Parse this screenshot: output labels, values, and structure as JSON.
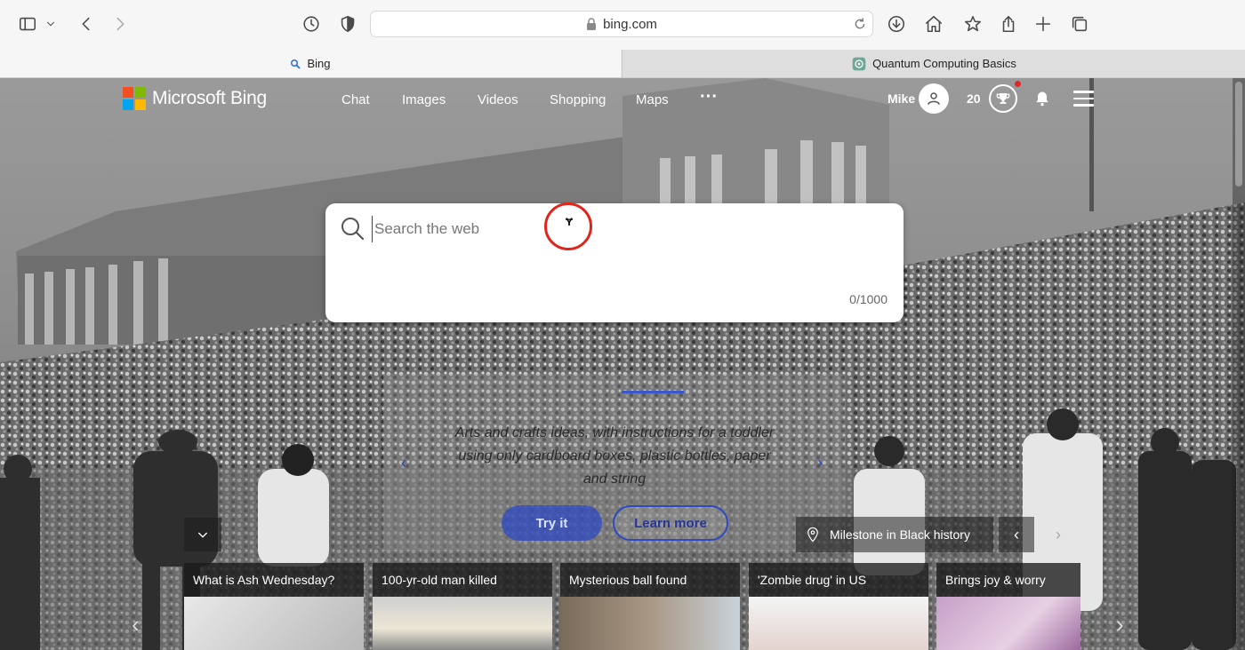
{
  "browser": {
    "url": "bing.com",
    "tabs": [
      {
        "label": "Bing",
        "active": true
      },
      {
        "label": "Quantum Computing Basics",
        "active": false
      }
    ]
  },
  "header": {
    "logo_text": "Microsoft Bing",
    "nav": [
      "Chat",
      "Images",
      "Videos",
      "Shopping",
      "Maps"
    ],
    "more": "···",
    "user_name": "Mike",
    "points": "20"
  },
  "search": {
    "placeholder": "Search the web",
    "value": "",
    "char_count": "0/1000"
  },
  "promo": {
    "text": "Arts and crafts ideas, with instructions for a toddler using only cardboard boxes, plastic bottles, paper and string",
    "try_label": "Try it",
    "learn_label": "Learn more"
  },
  "milestone": {
    "label": "Milestone in Black history"
  },
  "news_cards": [
    {
      "title": "What is Ash Wednesday?"
    },
    {
      "title": "100-yr-old man killed"
    },
    {
      "title": "Mysterious ball found"
    },
    {
      "title": "'Zombie drug' in US"
    },
    {
      "title": "Brings joy & worry"
    }
  ],
  "colors": {
    "ms_red": "#f25022",
    "ms_green": "#7fba00",
    "ms_blue": "#00a4ef",
    "ms_yellow": "#ffb900",
    "click_marker": "#e0251b",
    "promo_blue": "#2d49c3"
  }
}
